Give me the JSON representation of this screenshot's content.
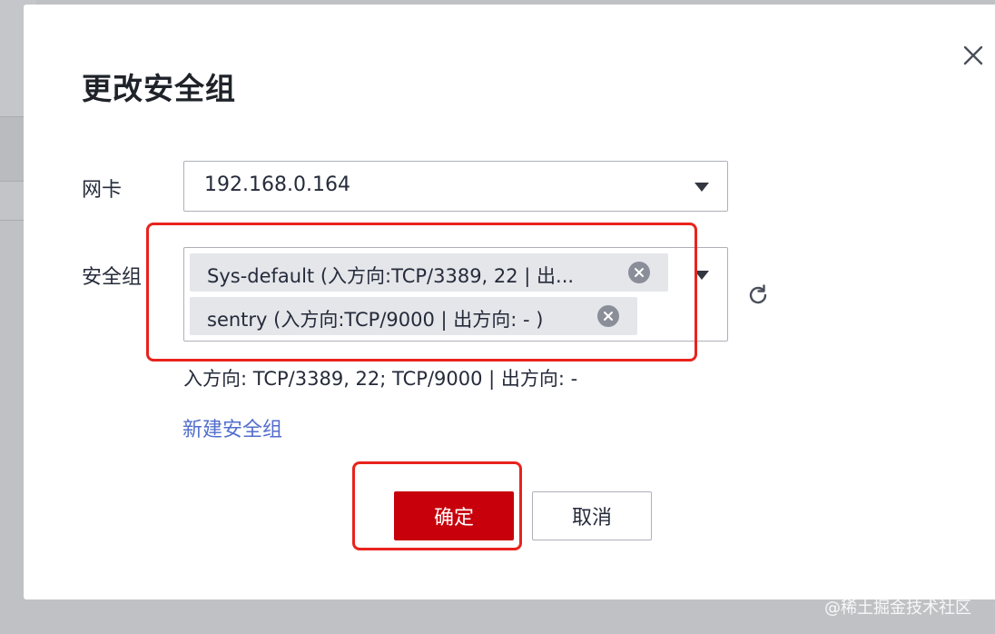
{
  "dialog": {
    "title": "更改安全组",
    "close_icon": "close-icon"
  },
  "nic": {
    "label": "网卡",
    "value": "192.168.0.164",
    "caret_icon": "caret-down-icon"
  },
  "security_group": {
    "label": "安全组",
    "tags": [
      {
        "text": "Sys-default (入方向:TCP/3389, 22 | 出...",
        "remove_icon": "remove-tag-icon"
      },
      {
        "text": "sentry (入方向:TCP/9000 | 出方向: - )",
        "remove_icon": "remove-tag-icon"
      }
    ],
    "caret_icon": "caret-down-icon",
    "refresh_icon": "refresh-icon",
    "rules_summary": "入方向: TCP/3389, 22; TCP/9000 | 出方向: -",
    "create_link": "新建安全组"
  },
  "buttons": {
    "confirm": "确定",
    "cancel": "取消"
  },
  "annotations": {
    "color": "#e8231d"
  },
  "colors": {
    "primary": "#c7000b",
    "link": "#526ecc"
  },
  "watermark": "@稀土掘金技术社区"
}
